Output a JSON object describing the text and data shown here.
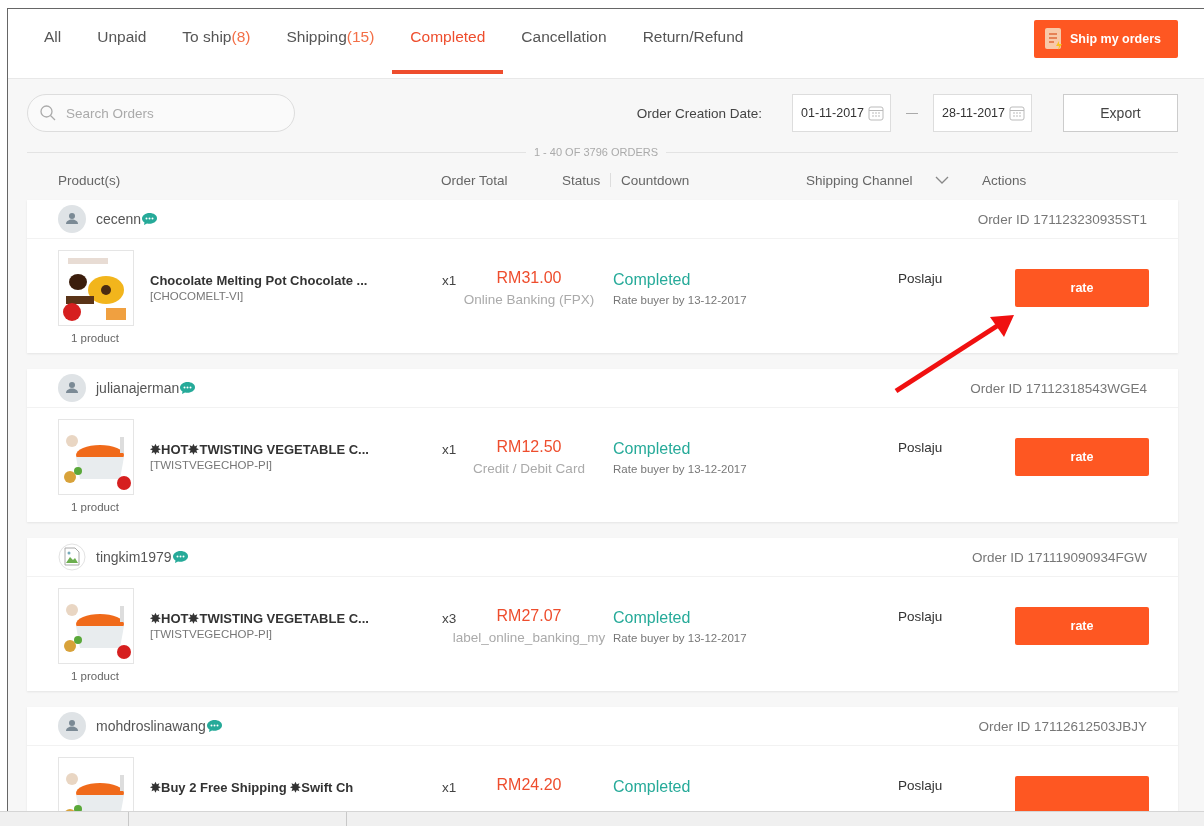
{
  "tabs": [
    {
      "label": "All",
      "selected": false
    },
    {
      "label": "Unpaid",
      "selected": false
    },
    {
      "label": "To ship",
      "count": "(8)",
      "selected": false
    },
    {
      "label": "Shipping",
      "count": "(15)",
      "selected": false
    },
    {
      "label": "Completed",
      "selected": true
    },
    {
      "label": "Cancellation",
      "selected": false
    },
    {
      "label": "Return/Refund",
      "selected": false
    }
  ],
  "ship_button": "Ship my orders",
  "search": {
    "placeholder": "Search Orders"
  },
  "date_filter": {
    "label": "Order Creation Date:",
    "from": "01-11-2017",
    "to": "28-11-2017"
  },
  "export_button": "Export",
  "order_count": "1 - 40 OF 3796 ORDERS",
  "columns": [
    "Product(s)",
    "Order Total",
    "Status",
    "Countdown",
    "Shipping Channel",
    "Actions"
  ],
  "orders": [
    {
      "buyer": "cecenn",
      "avatar": {
        "kind": "default"
      },
      "order_id": "Order ID 171123230935ST1",
      "product": "Chocolate Melting Pot Chocolate ...",
      "sku": "[CHOCOMELT-VI]",
      "product_count": "1 product",
      "qty": "x1",
      "total": "RM31.00",
      "payment": "Online Banking (FPX)",
      "status": "Completed",
      "status_note": "Rate buyer by 13-12-2017",
      "shipping": "Poslaju",
      "action": "rate"
    },
    {
      "buyer": "julianajerman",
      "avatar": {
        "kind": "default"
      },
      "order_id": "Order ID 17112318543WGE4",
      "product": "✸HOT✸TWISTING VEGETABLE C...",
      "sku": "[TWISTVEGECHOP-PI]",
      "product_count": "1 product",
      "qty": "x1",
      "total": "RM12.50",
      "payment": "Credit / Debit Card",
      "status": "Completed",
      "status_note": "Rate buyer by 13-12-2017",
      "shipping": "Poslaju",
      "action": "rate"
    },
    {
      "buyer": "tingkim1979",
      "avatar": {
        "kind": "broken"
      },
      "order_id": "Order ID 171119090934FGW",
      "product": "✸HOT✸TWISTING VEGETABLE C...",
      "sku": "[TWISTVEGECHOP-PI]",
      "product_count": "1 product",
      "qty": "x3",
      "total": "RM27.07",
      "payment": "label_online_banking_my",
      "status": "Completed",
      "status_note": "Rate buyer by 13-12-2017",
      "shipping": "Poslaju",
      "action": "rate"
    },
    {
      "buyer": "mohdroslinawang",
      "avatar": {
        "kind": "default"
      },
      "order_id": "Order ID 17112612503JBJY",
      "product": "✸Buy 2 Free Shipping ✸Swift Ch",
      "qty": "x1",
      "total": "RM24.20",
      "status": "Completed",
      "shipping": "Poslaju"
    }
  ]
}
